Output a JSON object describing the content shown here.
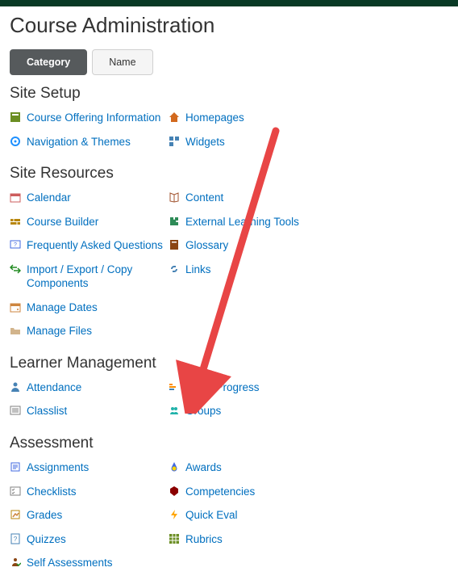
{
  "page_title": "Course Administration",
  "tabs": [
    {
      "label": "Category",
      "active": true
    },
    {
      "label": "Name",
      "active": false
    }
  ],
  "sections": [
    {
      "title": "Site Setup",
      "items": [
        {
          "label": "Course Offering Information",
          "icon": "info-box-icon",
          "color": "#6b8e23"
        },
        {
          "label": "Homepages",
          "icon": "home-icon",
          "color": "#d2691e"
        },
        {
          "label": "Navigation & Themes",
          "icon": "target-icon",
          "color": "#1e90ff"
        },
        {
          "label": "Widgets",
          "icon": "widget-icon",
          "color": "#4682b4"
        }
      ]
    },
    {
      "title": "Site Resources",
      "items": [
        {
          "label": "Calendar",
          "icon": "calendar-icon",
          "color": "#cd5c5c"
        },
        {
          "label": "Content",
          "icon": "book-icon",
          "color": "#a0522d"
        },
        {
          "label": "Course Builder",
          "icon": "brick-icon",
          "color": "#b8860b"
        },
        {
          "label": "External Learning Tools",
          "icon": "puzzle-icon",
          "color": "#2e8b57"
        },
        {
          "label": "Frequently Asked Questions",
          "icon": "faq-icon",
          "color": "#4169e1"
        },
        {
          "label": "Glossary",
          "icon": "glossary-icon",
          "color": "#8b4513"
        },
        {
          "label": "Import / Export / Copy Components",
          "icon": "arrows-icon",
          "color": "#228b22"
        },
        {
          "label": "Links",
          "icon": "link-icon",
          "color": "#4682b4"
        },
        {
          "label": "Manage Dates",
          "icon": "dates-icon",
          "color": "#cd853f"
        },
        {
          "label": "",
          "icon": "",
          "color": ""
        },
        {
          "label": "Manage Files",
          "icon": "folder-icon",
          "color": "#d2b48c"
        }
      ]
    },
    {
      "title": "Learner Management",
      "items": [
        {
          "label": "Attendance",
          "icon": "person-icon",
          "color": "#4682b4"
        },
        {
          "label": "Class Progress",
          "icon": "progress-icon",
          "color": "#ff8c00"
        },
        {
          "label": "Classlist",
          "icon": "list-icon",
          "color": "#808080"
        },
        {
          "label": "Groups",
          "icon": "groups-icon",
          "color": "#20b2aa"
        }
      ]
    },
    {
      "title": "Assessment",
      "items": [
        {
          "label": "Assignments",
          "icon": "assignment-icon",
          "color": "#4169e1"
        },
        {
          "label": "Awards",
          "icon": "award-icon",
          "color": "#4169e1"
        },
        {
          "label": "Checklists",
          "icon": "checklist-icon",
          "color": "#808080"
        },
        {
          "label": "Competencies",
          "icon": "competency-icon",
          "color": "#8b0000"
        },
        {
          "label": "Grades",
          "icon": "grades-icon",
          "color": "#b8860b"
        },
        {
          "label": "Quick Eval",
          "icon": "bolt-icon",
          "color": "#ffa500"
        },
        {
          "label": "Quizzes",
          "icon": "quiz-icon",
          "color": "#4682b4"
        },
        {
          "label": "Rubrics",
          "icon": "rubric-icon",
          "color": "#6b8e23"
        },
        {
          "label": "Self Assessments",
          "icon": "self-icon",
          "color": "#8b4513"
        }
      ]
    }
  ]
}
